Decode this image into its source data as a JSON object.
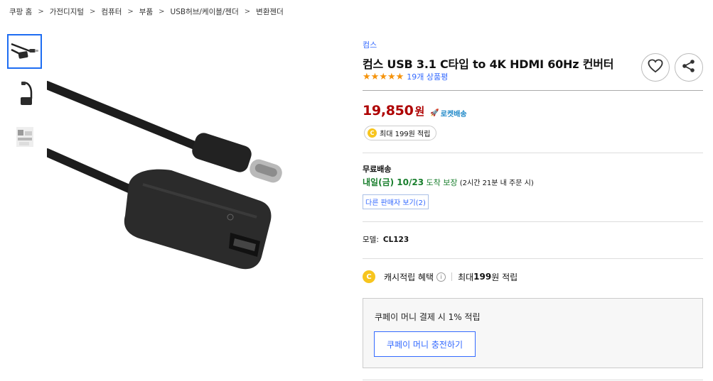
{
  "breadcrumb": [
    "쿠팡 홈",
    "가전디지털",
    "컴퓨터",
    "부품",
    "USB허브/케이블/젠더",
    "변환젠더"
  ],
  "product": {
    "brand": "컴스",
    "title": "컴스 USB 3.1 C타입 to 4K HDMI 60Hz 컨버터",
    "rating_stars": 5,
    "review_count": "19개 상품평",
    "price": "19,850",
    "currency": "원",
    "rocket_label": "로켓배송",
    "cash_pill": "최대 199원 적립",
    "coin_letter": "C"
  },
  "shipping": {
    "title": "무료배송",
    "arrival_date": "내일(금) 10/23",
    "arrival_guarantee": " 도착 보장",
    "arrival_condition": " (2시간 21분 내 주문 시)",
    "other_sellers": "다른 판매자 보기(2)"
  },
  "model": {
    "label": "모델:",
    "value": "CL123"
  },
  "cash_benefit": {
    "label": "캐시적립 혜택",
    "info": "i",
    "prefix": "최대 ",
    "amount": "199",
    "suffix": "원 적립"
  },
  "coupay": {
    "text": "쿠페이 머니 결제 시 1% 적립",
    "button": "쿠페이 머니 충전하기"
  },
  "icons": {
    "wishlist": "heart-icon",
    "share": "share-icon"
  },
  "colors": {
    "price": "#ae0000",
    "link": "#346aff",
    "star": "#f5930b",
    "arrival": "#1a7f2e",
    "coin": "#f7c51e"
  }
}
